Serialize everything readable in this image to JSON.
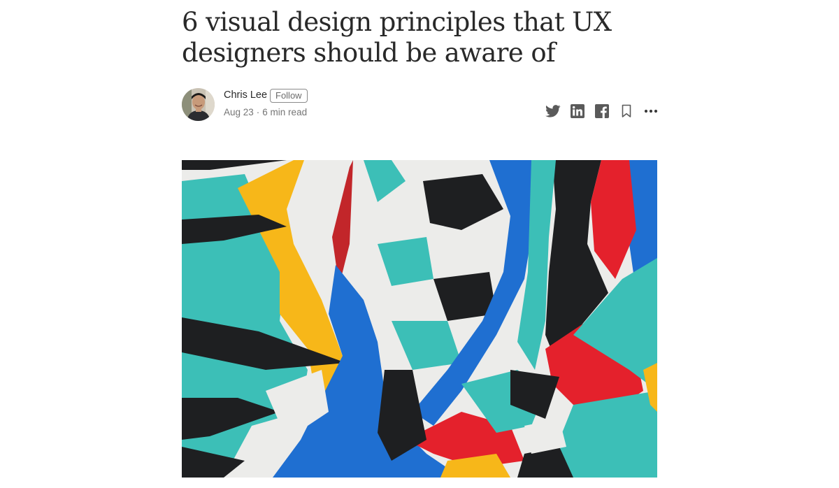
{
  "article": {
    "title": "6 visual design principles that UX designers should be aware of",
    "author": {
      "name": "Chris Lee",
      "follow_label": "Follow",
      "avatar": "author-photo"
    },
    "date": "Aug 23",
    "separator": "·",
    "read_time": "6 min read"
  },
  "share_actions": [
    {
      "name": "twitter",
      "icon": "twitter-icon"
    },
    {
      "name": "linkedin",
      "icon": "linkedin-icon"
    },
    {
      "name": "facebook",
      "icon": "facebook-icon"
    },
    {
      "name": "bookmark",
      "icon": "bookmark-icon"
    },
    {
      "name": "more",
      "icon": "more-options-icon"
    }
  ],
  "hero_image": {
    "description_icon": "abstract-mural-image",
    "palette": {
      "black": "#1e1f21",
      "white": "#ececea",
      "teal": "#3cbfb7",
      "blue": "#1f6fd1",
      "red": "#e4212c",
      "yellow": "#f7b719"
    }
  }
}
